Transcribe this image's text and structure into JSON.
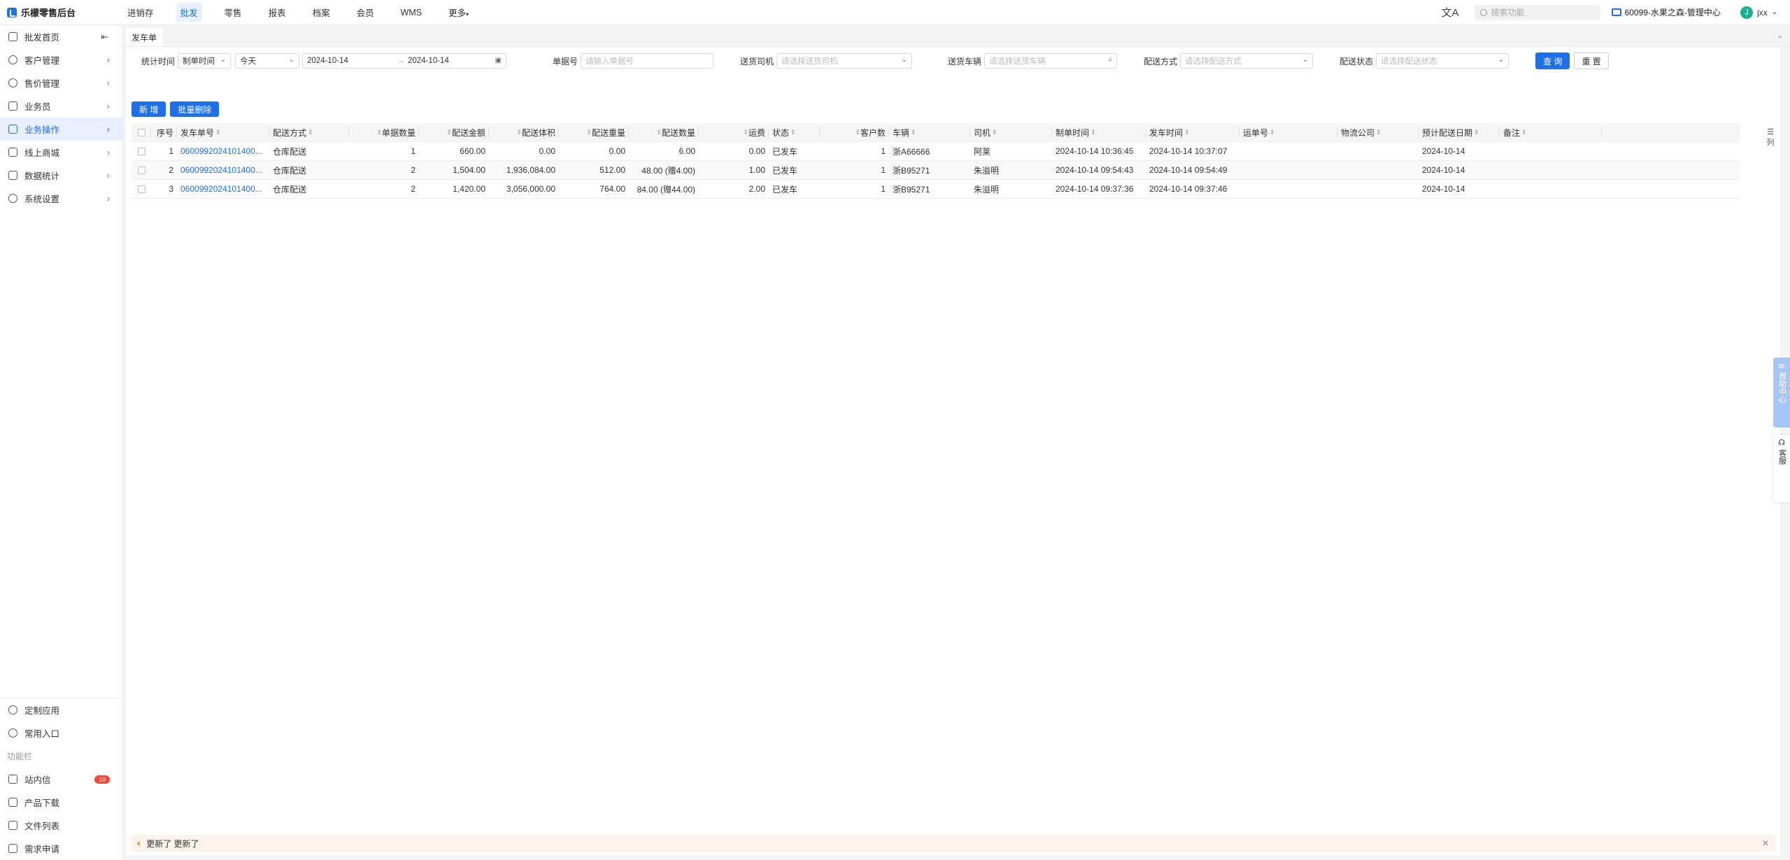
{
  "brand": {
    "name": "乐檬零售后台"
  },
  "topnav": [
    "进销存",
    "批发",
    "零售",
    "报表",
    "档案",
    "会员",
    "WMS",
    "更多"
  ],
  "topbar": {
    "search_placeholder": "搜索功能",
    "store": "60099-水果之森-管理中心",
    "avatar_letter": "J",
    "user": "jxx"
  },
  "sidebar": {
    "items": [
      "批发首页",
      "客户管理",
      "售价管理",
      "业务员",
      "业务操作",
      "线上商城",
      "数据统计",
      "系统设置"
    ],
    "bottom": {
      "custom_apps": "定制应用",
      "common_entry": "常用入口",
      "section_label": "功能栏",
      "messages": "站内信",
      "messages_badge": "10",
      "downloads": "产品下载",
      "files": "文件列表",
      "requests": "需求申请"
    }
  },
  "tab": {
    "label": "发车单"
  },
  "filters": {
    "stat_time_label": "统计时间",
    "time_type": "制单时间",
    "period": "今天",
    "date_from": "2024-10-14",
    "date_sep": "→",
    "date_to": "2024-10-14",
    "bill_no_label": "单据号",
    "bill_no_placeholder": "请输入单据号",
    "driver_label": "送货司机",
    "driver_placeholder": "请选择送货司机",
    "vehicle_label": "送货车辆",
    "vehicle_placeholder": "请选择送货车辆",
    "method_label": "配送方式",
    "method_placeholder": "请选择配送方式",
    "status_label": "配送状态",
    "status_placeholder": "请选择配送状态",
    "query": "查 询",
    "reset": "重 置"
  },
  "actions": {
    "add": "新 增",
    "batch_delete": "批量删除"
  },
  "table": {
    "headers": [
      "序号",
      "发车单号",
      "配送方式",
      "单据数量",
      "配送金额",
      "配送体积",
      "配送重量",
      "配送数量",
      "运费",
      "状态",
      "客户数",
      "车辆",
      "司机",
      "制单时间",
      "发车时间",
      "运单号",
      "物流公司",
      "预计配送日期",
      "备注"
    ],
    "rows": [
      [
        "1",
        "0600992024101400...",
        "仓库配送",
        "1",
        "660.00",
        "0.00",
        "0.00",
        "6.00",
        "0.00",
        "已发车",
        "1",
        "浙A66666",
        "阿莱",
        "2024-10-14 10:36:45",
        "2024-10-14 10:37:07",
        "",
        "",
        "2024-10-14",
        ""
      ],
      [
        "2",
        "0600992024101400...",
        "仓库配送",
        "2",
        "1,504.00",
        "1,936,084.00",
        "512.00",
        "48.00 (赠4.00)",
        "1.00",
        "已发车",
        "1",
        "浙B95271",
        "朱溢明",
        "2024-10-14 09:54:43",
        "2024-10-14 09:54:49",
        "",
        "",
        "2024-10-14",
        ""
      ],
      [
        "3",
        "0600992024101400...",
        "仓库配送",
        "2",
        "1,420.00",
        "3,056,000.00",
        "764.00",
        "84.00 (赠44.00)",
        "2.00",
        "已发车",
        "1",
        "浙B95271",
        "朱溢明",
        "2024-10-14 09:37:36",
        "2024-10-14 09:37:46",
        "",
        "",
        "2024-10-14",
        ""
      ]
    ]
  },
  "column_toggle": "列",
  "help_center": "帮助中心",
  "customer_service": "客服",
  "notice": {
    "text": "更新了 更新了"
  }
}
